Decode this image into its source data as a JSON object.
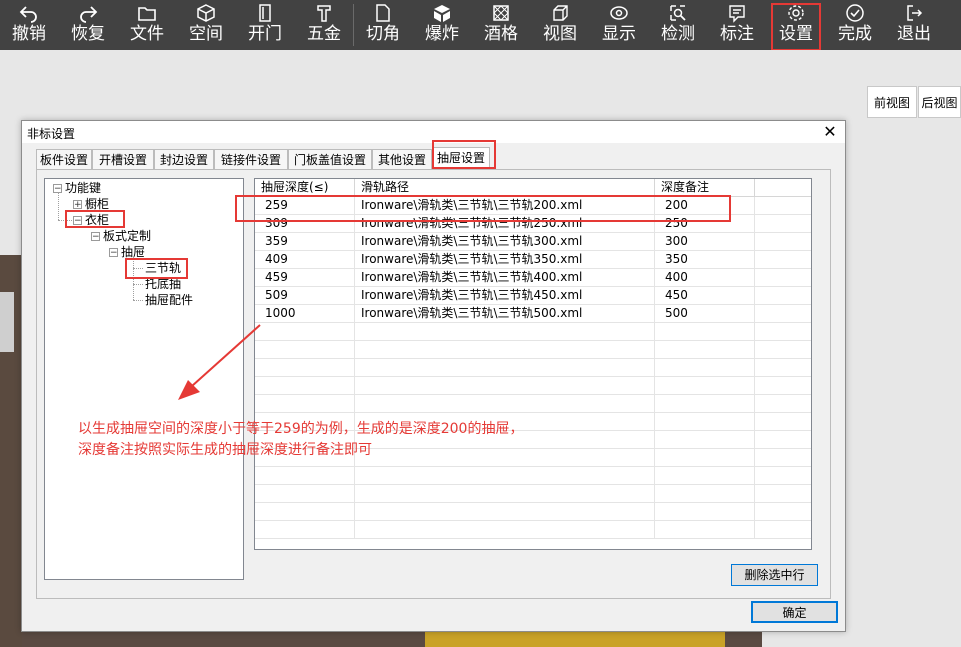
{
  "toolbar": {
    "items": [
      {
        "label": "撤销",
        "icon": "undo-icon"
      },
      {
        "label": "恢复",
        "icon": "redo-icon"
      },
      {
        "label": "文件",
        "icon": "folder-icon"
      },
      {
        "label": "空间",
        "icon": "cube-icon"
      },
      {
        "label": "开门",
        "icon": "door-icon"
      },
      {
        "label": "五金",
        "icon": "hardware-icon"
      },
      {
        "label": "切角",
        "icon": "cut-corner-icon"
      },
      {
        "label": "爆炸",
        "icon": "explode-icon"
      },
      {
        "label": "酒格",
        "icon": "wine-grid-icon"
      },
      {
        "label": "视图",
        "icon": "view-icon"
      },
      {
        "label": "显示",
        "icon": "eye-icon"
      },
      {
        "label": "检测",
        "icon": "detect-icon"
      },
      {
        "label": "标注",
        "icon": "annotation-icon"
      },
      {
        "label": "设置",
        "icon": "gear-icon"
      },
      {
        "label": "完成",
        "icon": "check-circle-icon"
      },
      {
        "label": "退出",
        "icon": "exit-icon"
      }
    ]
  },
  "view_tabs": [
    "前视图",
    "后视图"
  ],
  "dialog": {
    "title": "非标设置",
    "close": "✕",
    "tabs": [
      "板件设置",
      "开槽设置",
      "封边设置",
      "链接件设置",
      "门板盖值设置",
      "其他设置",
      "抽屉设置"
    ],
    "active_tab": "抽屉设置",
    "tree": {
      "root": "功能键",
      "n1": "橱柜",
      "n2": "衣柜",
      "n3": "板式定制",
      "n4": "抽屉",
      "n5": "三节轨",
      "n6": "托底抽",
      "n7": "抽屉配件"
    },
    "grid": {
      "headers": [
        "抽屉深度(≤)",
        "滑轨路径",
        "深度备注"
      ],
      "rows": [
        [
          "259",
          "Ironware\\滑轨类\\三节轨\\三节轨200.xml",
          "200"
        ],
        [
          "309",
          "Ironware\\滑轨类\\三节轨\\三节轨250.xml",
          "250"
        ],
        [
          "359",
          "Ironware\\滑轨类\\三节轨\\三节轨300.xml",
          "300"
        ],
        [
          "409",
          "Ironware\\滑轨类\\三节轨\\三节轨350.xml",
          "350"
        ],
        [
          "459",
          "Ironware\\滑轨类\\三节轨\\三节轨400.xml",
          "400"
        ],
        [
          "509",
          "Ironware\\滑轨类\\三节轨\\三节轨450.xml",
          "450"
        ],
        [
          "1000",
          "Ironware\\滑轨类\\三节轨\\三节轨500.xml",
          "500"
        ]
      ]
    },
    "delete_button": "删除选中行",
    "ok_button": "确定"
  },
  "annotation": {
    "line1": "以生成抽屉空间的深度小于等于259的为例，生成的是深度200的抽屉，",
    "line2": "深度备注按照实际生成的抽屉深度进行备注即可",
    "color": "#e53935"
  }
}
